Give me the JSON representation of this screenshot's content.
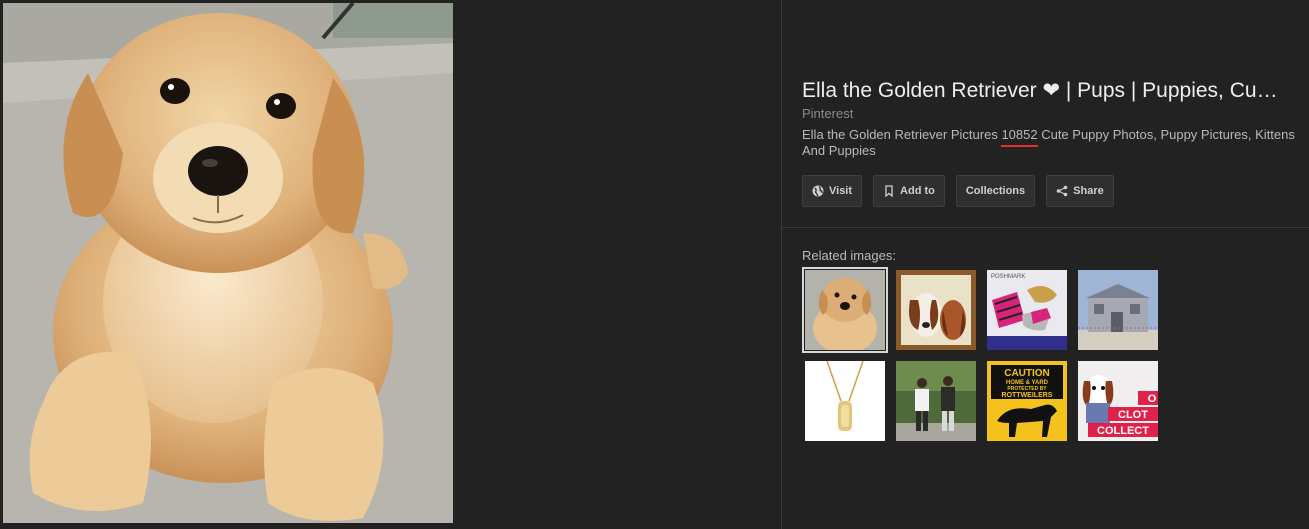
{
  "viewer": {
    "main_image": {
      "subject": "golden-retriever-puppy"
    }
  },
  "result": {
    "title": "Ella the Golden Retriever ❤ | Pups | Puppies, Cu…",
    "source": "Pinterest",
    "description_before": "Ella the Golden Retriever Pictures ",
    "description_highlight": "10852",
    "description_after": " Cute Puppy Photos, Puppy Pictures, Kittens And Puppies"
  },
  "actions": {
    "visit": "Visit",
    "add_to": "Add to",
    "collections": "Collections",
    "share": "Share"
  },
  "related": {
    "label": "Related images:",
    "thumbs": [
      {
        "subject": "golden-retriever-puppy",
        "selected": true
      },
      {
        "subject": "basset-hound-painting"
      },
      {
        "subject": "pink-zebra-dog-toys",
        "text": "POSHMARK"
      },
      {
        "subject": "grey-house"
      },
      {
        "subject": "gold-tag-necklace"
      },
      {
        "subject": "people-walking"
      },
      {
        "subject": "caution-rottweilers-sign",
        "text": [
          "CAUTION",
          "HOME & YARD",
          "PROTECTED BY",
          "ROTTWEILERS"
        ]
      },
      {
        "subject": "dog-clothes-collection",
        "text": [
          "O",
          "CLOT",
          "COLLECT"
        ]
      }
    ]
  },
  "colors": {
    "background": "#222222",
    "divider": "#3a3a3a",
    "highlight_underline": "#e0322a"
  }
}
